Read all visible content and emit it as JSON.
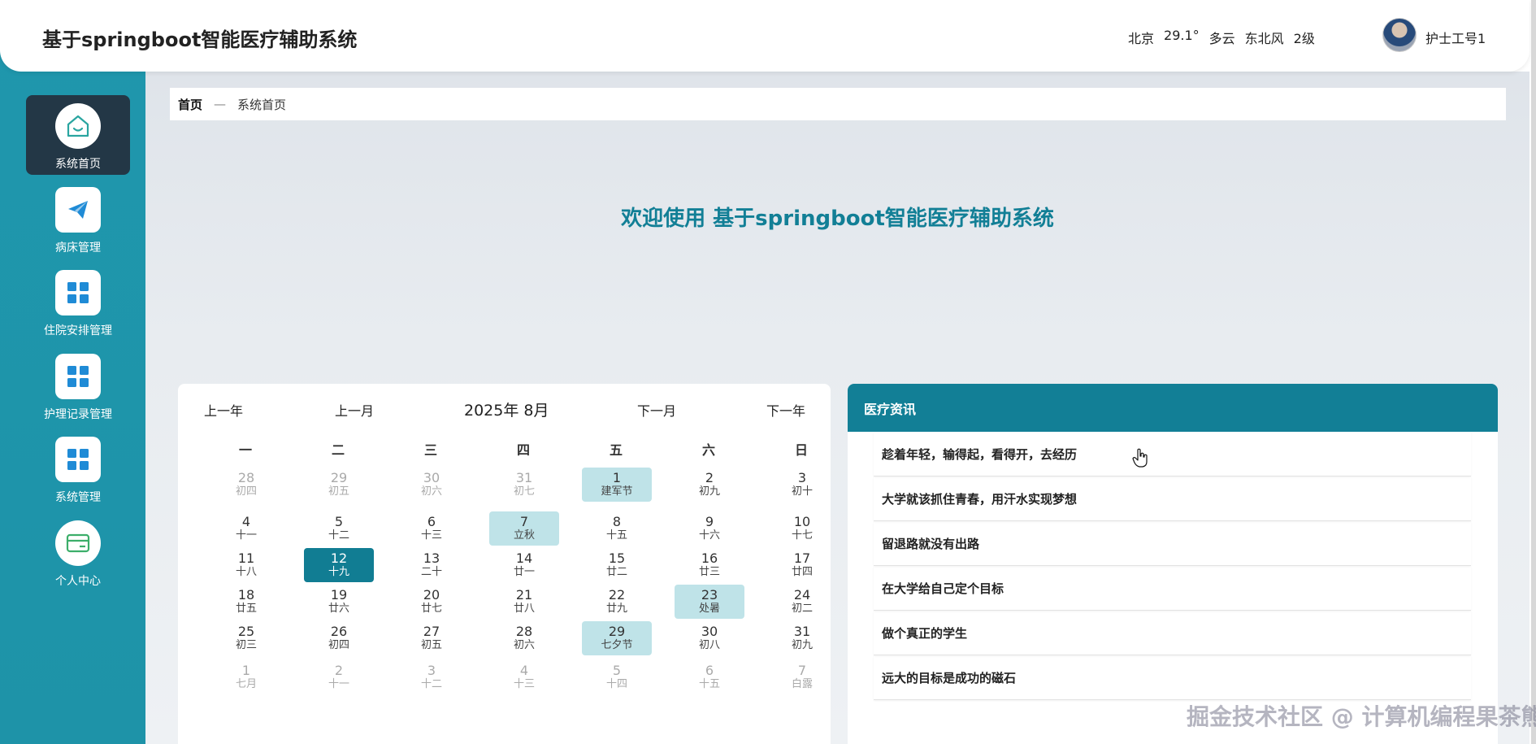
{
  "header": {
    "title": "基于springboot智能医疗辅助系统",
    "weather": {
      "city": "北京",
      "temp": "29.1°",
      "condition": "多云",
      "wind": "东北风",
      "level": "2级"
    },
    "user": "护士工号1"
  },
  "sidebar": {
    "items": [
      {
        "label": "系统首页",
        "icon": "home-icon",
        "active": true
      },
      {
        "label": "病床管理",
        "icon": "paper-plane-icon"
      },
      {
        "label": "住院安排管理",
        "icon": "grid-icon"
      },
      {
        "label": "护理记录管理",
        "icon": "grid-icon"
      },
      {
        "label": "系统管理",
        "icon": "grid-icon"
      },
      {
        "label": "个人中心",
        "icon": "card-icon"
      }
    ]
  },
  "breadcrumb": {
    "home": "首页",
    "sep": "—",
    "current": "系统首页"
  },
  "welcome": "欢迎使用 基于springboot智能医疗辅助系统",
  "calendar": {
    "prev_year": "上一年",
    "prev_month": "上一月",
    "year_month": "2025年 8月",
    "next_month": "下一月",
    "next_year": "下一年",
    "weekdays": [
      "一",
      "二",
      "三",
      "四",
      "五",
      "六",
      "日"
    ],
    "rows": [
      [
        {
          "d": "28",
          "l": "初四",
          "o": true
        },
        {
          "d": "29",
          "l": "初五",
          "o": true
        },
        {
          "d": "30",
          "l": "初六",
          "o": true
        },
        {
          "d": "31",
          "l": "初七",
          "o": true
        },
        {
          "d": "1",
          "l": "建军节",
          "h": true
        },
        {
          "d": "2",
          "l": "初九"
        },
        {
          "d": "3",
          "l": "初十"
        }
      ],
      [
        {
          "d": "4",
          "l": "十一"
        },
        {
          "d": "5",
          "l": "十二"
        },
        {
          "d": "6",
          "l": "十三"
        },
        {
          "d": "7",
          "l": "立秋",
          "h": true
        },
        {
          "d": "8",
          "l": "十五"
        },
        {
          "d": "9",
          "l": "十六"
        },
        {
          "d": "10",
          "l": "十七"
        }
      ],
      [
        {
          "d": "11",
          "l": "十八"
        },
        {
          "d": "12",
          "l": "十九",
          "t": true
        },
        {
          "d": "13",
          "l": "二十"
        },
        {
          "d": "14",
          "l": "廿一"
        },
        {
          "d": "15",
          "l": "廿二"
        },
        {
          "d": "16",
          "l": "廿三"
        },
        {
          "d": "17",
          "l": "廿四"
        }
      ],
      [
        {
          "d": "18",
          "l": "廿五"
        },
        {
          "d": "19",
          "l": "廿六"
        },
        {
          "d": "20",
          "l": "廿七"
        },
        {
          "d": "21",
          "l": "廿八"
        },
        {
          "d": "22",
          "l": "廿九"
        },
        {
          "d": "23",
          "l": "处暑",
          "h": true
        },
        {
          "d": "24",
          "l": "初二"
        }
      ],
      [
        {
          "d": "25",
          "l": "初三"
        },
        {
          "d": "26",
          "l": "初四"
        },
        {
          "d": "27",
          "l": "初五"
        },
        {
          "d": "28",
          "l": "初六"
        },
        {
          "d": "29",
          "l": "七夕节",
          "h": true
        },
        {
          "d": "30",
          "l": "初八"
        },
        {
          "d": "31",
          "l": "初九"
        }
      ],
      [
        {
          "d": "1",
          "l": "七月",
          "o": true
        },
        {
          "d": "2",
          "l": "十一",
          "o": true
        },
        {
          "d": "3",
          "l": "十二",
          "o": true
        },
        {
          "d": "4",
          "l": "十三",
          "o": true
        },
        {
          "d": "5",
          "l": "十四",
          "o": true
        },
        {
          "d": "6",
          "l": "十五",
          "o": true
        },
        {
          "d": "7",
          "l": "白露",
          "o": true
        }
      ]
    ]
  },
  "news": {
    "title": "医疗资讯",
    "items": [
      "趁着年轻，输得起，看得开，去经历",
      "大学就该抓住青春，用汗水实现梦想",
      "留退路就没有出路",
      "在大学给自己定个目标",
      "做个真正的学生",
      "远大的目标是成功的磁石"
    ]
  },
  "watermark": "掘金技术社区 @ 计算机编程果茶熊"
}
